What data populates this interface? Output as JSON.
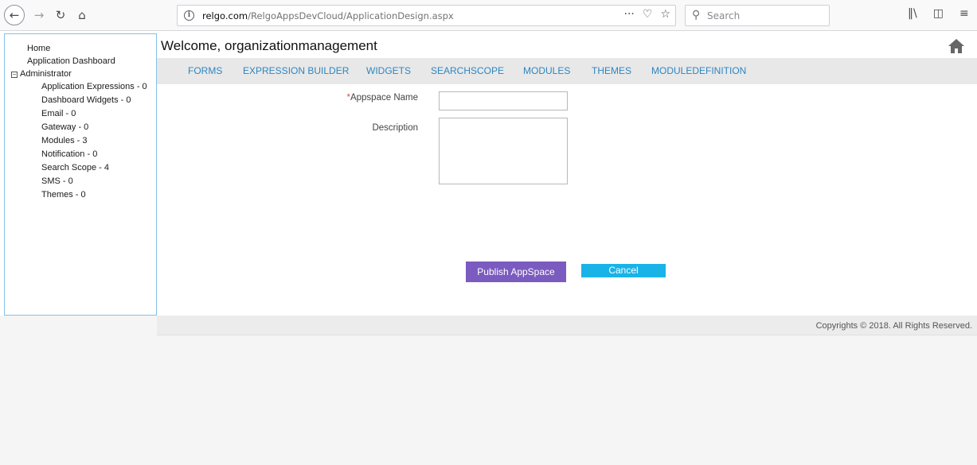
{
  "browser": {
    "url_domain": "relgo.com",
    "url_path": "/RelgoAppsDevCloud/ApplicationDesign.aspx",
    "search_placeholder": "Search",
    "icons": [
      "back-arrow-icon",
      "forward-arrow-icon",
      "reload-icon",
      "home-icon",
      "info-icon",
      "more-icon",
      "pocket-icon",
      "bookmark-star-icon",
      "search-icon",
      "library-icon",
      "sidebar-icon",
      "menu-icon"
    ]
  },
  "sidebar": {
    "home": "Home",
    "dashboard": "Application Dashboard",
    "administrator": "Administrator",
    "items": [
      "Application Expressions - 0",
      "Dashboard Widgets - 0",
      "Email - 0",
      "Gateway - 0",
      "Modules - 3",
      "Notification - 0",
      "Search Scope - 4",
      "SMS - 0",
      "Themes - 0"
    ]
  },
  "header": {
    "welcome": "Welcome, organizationmanagement"
  },
  "menu": [
    "FORMS",
    "EXPRESSION BUILDER",
    "WIDGETS",
    "SEARCHSCOPE",
    "MODULES",
    "THEMES",
    "MODULEDEFINITION"
  ],
  "form": {
    "required_mark": "*",
    "appspace_label": "Appspace Name",
    "appspace_value": "",
    "description_label": "Description",
    "description_value": "",
    "publish_label": "Publish AppSpace",
    "cancel_label": "Cancel"
  },
  "footer": {
    "copyright": "Copyrights © 2018. All Rights Reserved."
  },
  "colors": {
    "menu_link": "#2e86c1",
    "publish_button": "#7b5bbf",
    "cancel_button": "#1ab3e8",
    "sidebar_border": "#86c2e6"
  }
}
